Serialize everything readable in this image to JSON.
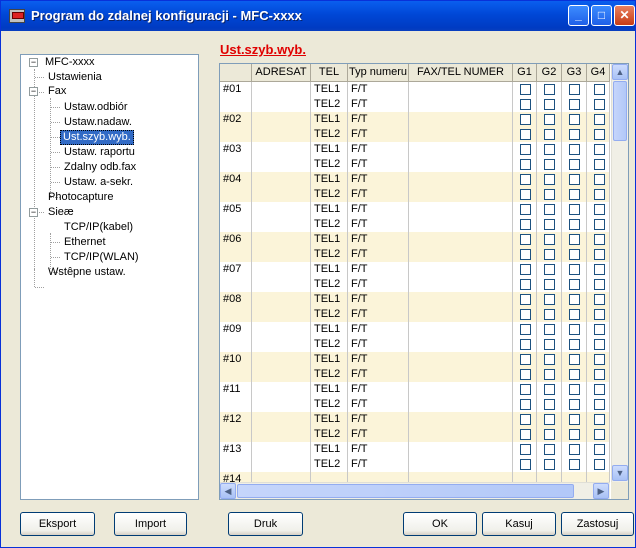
{
  "window": {
    "title": "Program do zdalnej konfiguracji - MFC-xxxx"
  },
  "tree": {
    "root": "MFC-xxxx",
    "items": [
      {
        "label": "Ustawienia"
      },
      {
        "label": "Fax"
      },
      {
        "label": "Ustaw.odbiór"
      },
      {
        "label": "Ustaw.nadaw."
      },
      {
        "label": "Ust.szyb.wyb.",
        "selected": true
      },
      {
        "label": "Ustaw. raportu"
      },
      {
        "label": "Zdalny odb.fax"
      },
      {
        "label": "Ustaw. a-sekr."
      },
      {
        "label": "Photocapture"
      },
      {
        "label": "Sieæ"
      },
      {
        "label": "TCP/IP(kabel)"
      },
      {
        "label": "Ethernet"
      },
      {
        "label": "TCP/IP(WLAN)"
      },
      {
        "label": "Wstêpne ustaw."
      }
    ]
  },
  "panel": {
    "title": "Ust.szyb.wyb."
  },
  "grid": {
    "headers": [
      "",
      "ADRESAT",
      "TEL",
      "Typ numeru",
      "FAX/TEL NUMER",
      "G1",
      "G2",
      "G3",
      "G4"
    ],
    "entries": [
      "#01",
      "#02",
      "#03",
      "#04",
      "#05",
      "#06",
      "#07",
      "#08",
      "#09",
      "#10",
      "#11",
      "#12",
      "#13"
    ],
    "partial_entry": "#14",
    "tel_labels": [
      "TEL1",
      "TEL2"
    ],
    "type_value": "F/T"
  },
  "buttons": {
    "export": "Eksport",
    "import": "Import",
    "print": "Druk",
    "ok": "OK",
    "cancel": "Kasuj",
    "apply": "Zastosuj"
  },
  "icons": {
    "app": "printer-app-icon",
    "minimize": "minimize-icon",
    "maximize": "maximize-icon",
    "close": "close-icon"
  }
}
